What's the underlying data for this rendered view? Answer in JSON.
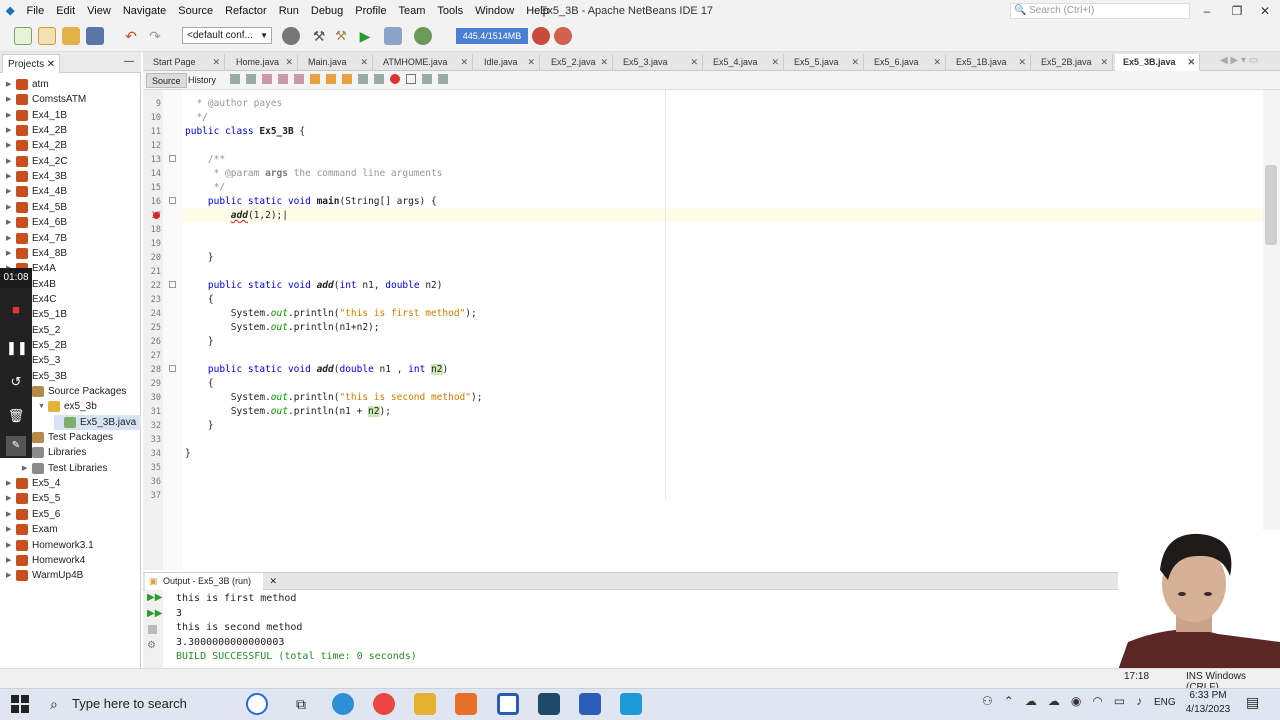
{
  "window": {
    "title": "Ex5_3B - Apache NetBeans IDE 17",
    "search_placeholder": "Search (Ctrl+I)",
    "minimize": "–",
    "maximize": "❐",
    "close": "✕"
  },
  "menu": [
    "File",
    "Edit",
    "View",
    "Navigate",
    "Source",
    "Refactor",
    "Run",
    "Debug",
    "Profile",
    "Team",
    "Tools",
    "Window",
    "Help"
  ],
  "toolbar": {
    "config": "<default conf...",
    "memory": "445.4/1514MB"
  },
  "projects": {
    "tab": "Projects",
    "items": [
      {
        "label": "atm",
        "indent": 0,
        "icon": "cup",
        "toggle": "▶"
      },
      {
        "label": "ComstsATM",
        "indent": 0,
        "icon": "cup",
        "toggle": "▶"
      },
      {
        "label": "Ex4_1B",
        "indent": 0,
        "icon": "cup",
        "toggle": "▶"
      },
      {
        "label": "Ex4_2B",
        "indent": 0,
        "icon": "cup",
        "toggle": "▶"
      },
      {
        "label": "Ex4_2B",
        "indent": 0,
        "icon": "cup",
        "toggle": "▶"
      },
      {
        "label": "Ex4_2C",
        "indent": 0,
        "icon": "cup",
        "toggle": "▶"
      },
      {
        "label": "Ex4_3B",
        "indent": 0,
        "icon": "cup",
        "toggle": "▶"
      },
      {
        "label": "Ex4_4B",
        "indent": 0,
        "icon": "cup",
        "toggle": "▶"
      },
      {
        "label": "Ex4_5B",
        "indent": 0,
        "icon": "cup",
        "toggle": "▶"
      },
      {
        "label": "Ex4_6B",
        "indent": 0,
        "icon": "cup",
        "toggle": "▶"
      },
      {
        "label": "Ex4_7B",
        "indent": 0,
        "icon": "cup",
        "toggle": "▶"
      },
      {
        "label": "Ex4_8B",
        "indent": 0,
        "icon": "cup",
        "toggle": "▶"
      },
      {
        "label": "Ex4A",
        "indent": 0,
        "icon": "cup",
        "toggle": "▶"
      },
      {
        "label": "Ex4B",
        "indent": 0,
        "icon": "cup",
        "toggle": "▶"
      },
      {
        "label": "Ex4C",
        "indent": 0,
        "icon": "cup",
        "toggle": "▶"
      },
      {
        "label": "Ex5_1B",
        "indent": 0,
        "icon": "cup",
        "toggle": "▶"
      },
      {
        "label": "Ex5_2",
        "indent": 0,
        "icon": "cup",
        "toggle": "▶"
      },
      {
        "label": "Ex5_2B",
        "indent": 0,
        "icon": "cup",
        "toggle": "▶"
      },
      {
        "label": "Ex5_3",
        "indent": 0,
        "icon": "cup",
        "toggle": "▶"
      },
      {
        "label": "Ex5_3B",
        "indent": 0,
        "icon": "cup",
        "toggle": "▼"
      },
      {
        "label": "Source Packages",
        "indent": 1,
        "icon": "fld",
        "toggle": "▼"
      },
      {
        "label": "ex5_3b",
        "indent": 2,
        "icon": "pkg",
        "toggle": "▼"
      },
      {
        "label": "Ex5_3B.java",
        "indent": 3,
        "icon": "jfile",
        "toggle": "",
        "selected": true
      },
      {
        "label": "Test Packages",
        "indent": 1,
        "icon": "fld",
        "toggle": "▶"
      },
      {
        "label": "Libraries",
        "indent": 1,
        "icon": "lib",
        "toggle": "▶"
      },
      {
        "label": "Test Libraries",
        "indent": 1,
        "icon": "lib",
        "toggle": "▶"
      },
      {
        "label": "Ex5_4",
        "indent": 0,
        "icon": "cup",
        "toggle": "▶"
      },
      {
        "label": "Ex5_5",
        "indent": 0,
        "icon": "cup",
        "toggle": "▶"
      },
      {
        "label": "Ex5_6",
        "indent": 0,
        "icon": "cup",
        "toggle": "▶"
      },
      {
        "label": "Exam",
        "indent": 0,
        "icon": "cup",
        "toggle": "▶"
      },
      {
        "label": "Homework3.1",
        "indent": 0,
        "icon": "cup",
        "toggle": "▶"
      },
      {
        "label": "Homework4",
        "indent": 0,
        "icon": "cup",
        "toggle": "▶"
      },
      {
        "label": "WarmUp4B",
        "indent": 0,
        "icon": "cup",
        "toggle": "▶"
      }
    ]
  },
  "recorder": {
    "time": "01:08"
  },
  "editor": {
    "tabs": [
      "Start Page",
      "Home.java",
      "Main.java",
      "ATMHOME.java",
      "Idle.java",
      "Ex5_2.java",
      "Ex5_3.java",
      "Ex5_4.java",
      "Ex5_5.java",
      "Ex5_6.java",
      "Ex5_1B.java",
      "Ex5_2B.java",
      "Ex5_3B.java"
    ],
    "active_tab": "Ex5_3B.java",
    "source_label": "Source",
    "history_label": "History",
    "line_numbers": [
      "9",
      "10",
      "11",
      "12",
      "13",
      "14",
      "15",
      "16",
      "17",
      "18",
      "19",
      "20",
      "21",
      "22",
      "23",
      "24",
      "25",
      "26",
      "27",
      "28",
      "29",
      "30",
      "31",
      "32",
      "33",
      "34",
      "35",
      "36",
      "37"
    ]
  },
  "output": {
    "tab": "Output - Ex5_3B (run)",
    "lines": [
      "this is first method",
      "3",
      "this is second method",
      "3.3000000000000003",
      "BUILD SUCCESSFUL (total time: 0 seconds)"
    ]
  },
  "status": {
    "position": "17:18",
    "mode": "INS Windows (CRLF)"
  },
  "taskbar": {
    "search": "Type here to search",
    "time": "6:33 PM",
    "date": "4/13/2023",
    "lang": "ENG"
  },
  "colors": {
    "accent": "#4a7fd4",
    "error": "#d22222",
    "success": "#2a8a2a"
  }
}
